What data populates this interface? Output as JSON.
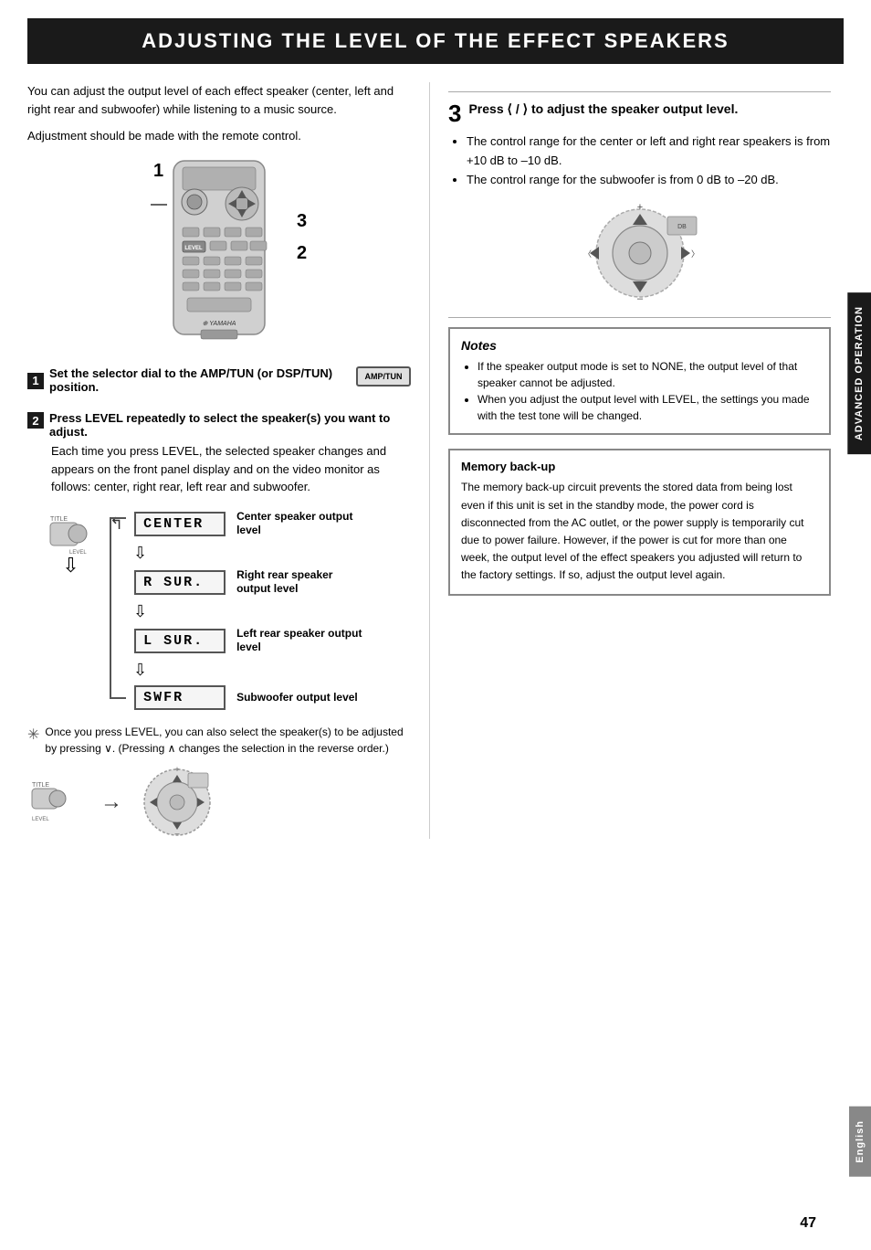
{
  "page": {
    "title": "ADJUSTING THE LEVEL OF THE EFFECT SPEAKERS",
    "page_number": "47"
  },
  "intro": {
    "text1": "You can adjust the output level of each effect speaker (center, left and right rear and subwoofer) while listening to a music source.",
    "text2": "Adjustment should be made with the remote control."
  },
  "step1": {
    "num": "1",
    "title": "Set the selector dial to the AMP/TUN (or DSP/TUN) position.",
    "amptun_label": "AMP/TUN"
  },
  "step2": {
    "num": "2",
    "title": "Press LEVEL repeatedly to select the speaker(s) you want to adjust.",
    "body": "Each time you press LEVEL, the selected speaker changes and appears on the front panel display and on the video monitor as follows: center, right rear, left rear and subwoofer."
  },
  "display_items": [
    {
      "text": "CENTER",
      "label": "Center speaker output level"
    },
    {
      "text": "R SUR.",
      "label": "Right rear speaker output level"
    },
    {
      "text": "L SUR.",
      "label": "Left rear speaker output level"
    },
    {
      "text": "SWFR",
      "label": "Subwoofer output level"
    }
  ],
  "step3": {
    "num": "3",
    "title": "Press ⟨ / ⟩ to adjust the speaker output level.",
    "bullets": [
      "The control range for the center or left and right rear speakers is from +10 dB to –10 dB.",
      "The control range for the subwoofer is from 0 dB to –20 dB."
    ]
  },
  "notes": {
    "title": "Notes",
    "items": [
      "If the speaker output mode is set to NONE, the output level of that speaker cannot be adjusted.",
      "When you adjust the output level with LEVEL, the settings you made with the test tone will be changed."
    ]
  },
  "memory_backup": {
    "title": "Memory back-up",
    "text": "The memory back-up circuit prevents the stored data from being lost even if this unit is set in the standby mode, the power cord is disconnected from the AC outlet, or the power supply is temporarily cut due to power failure. However, if the power is cut for more than one week, the output level of the effect speakers you adjusted will return to the factory settings. If so, adjust the output level again."
  },
  "tip": {
    "text": "Once you press LEVEL, you can also select the speaker(s) to be adjusted by pressing ∨. (Pressing ∧ changes the selection in the reverse order.)"
  },
  "side_tabs": {
    "advanced": "ADVANCED OPERATION",
    "english": "English"
  }
}
